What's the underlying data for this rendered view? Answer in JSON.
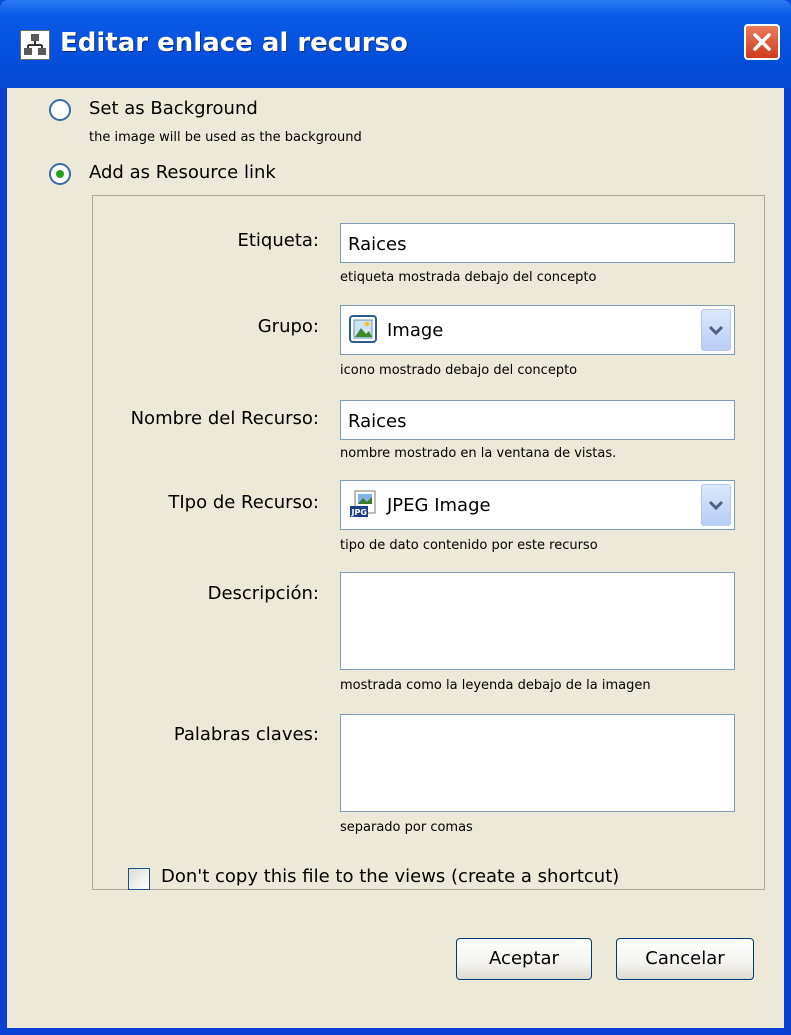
{
  "window": {
    "title": "Editar enlace al recurso",
    "title_icon": "network-icon",
    "close_icon": "close-icon"
  },
  "options": {
    "background": {
      "label": "Set as Background",
      "description": "the image will be used as the background",
      "selected": false
    },
    "resource_link": {
      "label": "Add as Resource link",
      "selected": true
    }
  },
  "form": {
    "etiqueta": {
      "label": "Etiqueta:",
      "value": "Raices",
      "hint": "etiqueta mostrada debajo del concepto"
    },
    "grupo": {
      "label": "Grupo:",
      "value": "Image",
      "icon": "image-icon",
      "hint": "icono mostrado debajo del concepto"
    },
    "nombre": {
      "label": "Nombre del Recurso:",
      "value": "Raices",
      "hint": "nombre mostrado en la ventana de vistas."
    },
    "tipo": {
      "label": "TIpo de Recurso:",
      "value": "JPEG Image",
      "icon": "jpeg-file-icon",
      "hint": "tipo de dato contenido por este recurso"
    },
    "descripcion": {
      "label": "Descripción:",
      "value": "",
      "hint": "mostrada como la leyenda debajo de la imagen"
    },
    "palabras": {
      "label": "Palabras claves:",
      "value": "",
      "hint": "separado por comas"
    },
    "shortcut": {
      "label": "Don't copy this file to the views (create a shortcut)",
      "checked": false
    }
  },
  "buttons": {
    "accept": "Aceptar",
    "cancel": "Cancelar"
  },
  "colors": {
    "title_bar": "#0550dc",
    "dialog_bg": "#ece9d8",
    "radio_dot": "#21a121",
    "close_red": "#cf3c1d"
  }
}
